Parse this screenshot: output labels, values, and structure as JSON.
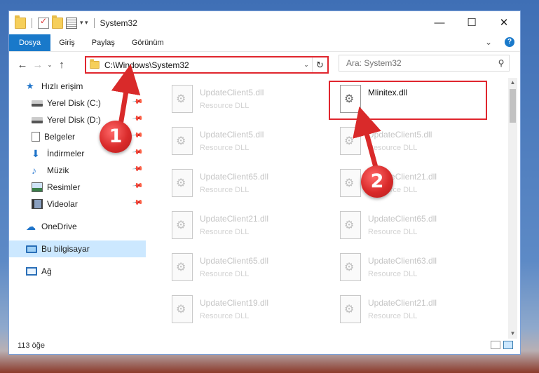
{
  "window": {
    "title": "System32"
  },
  "ribbon": {
    "tabs": [
      "Dosya",
      "Giriş",
      "Paylaş",
      "Görünüm"
    ]
  },
  "address": {
    "path": "C:\\Windows\\System32"
  },
  "search": {
    "placeholder": "Ara: System32"
  },
  "sidebar": {
    "quick_access": "Hızlı erişim",
    "items": [
      {
        "label": "Yerel Disk (C:)",
        "icon": "drive-icon"
      },
      {
        "label": "Yerel Disk (D:)",
        "icon": "drive-icon"
      },
      {
        "label": "Belgeler",
        "icon": "documents-icon"
      },
      {
        "label": "İndirmeler",
        "icon": "downloads-icon"
      },
      {
        "label": "Müzik",
        "icon": "music-icon"
      },
      {
        "label": "Resimler",
        "icon": "pictures-icon"
      },
      {
        "label": "Videolar",
        "icon": "videos-icon"
      }
    ],
    "onedrive": "OneDrive",
    "this_pc": "Bu bilgisayar",
    "network": "Ağ"
  },
  "files": {
    "left": [
      {
        "name": "UpdateClient5.dll",
        "type": "Resource DLL"
      },
      {
        "name": "UpdateClient5.dll",
        "type": "Resource DLL"
      },
      {
        "name": "UpdateClient65.dll",
        "type": "Resource DLL"
      },
      {
        "name": "UpdateClient21.dll",
        "type": "Resource DLL"
      },
      {
        "name": "UpdateClient65.dll",
        "type": "Resource DLL"
      },
      {
        "name": "UpdateClient19.dll",
        "type": "Resource DLL"
      }
    ],
    "right": [
      {
        "name": "Mlinitex.dll",
        "type": ""
      },
      {
        "name": "UpdateClient5.dll",
        "type": "Resource DLL"
      },
      {
        "name": "UpdateClient21.dll",
        "type": "Resource DLL"
      },
      {
        "name": "UpdateClient65.dll",
        "type": "Resource DLL"
      },
      {
        "name": "UpdateClient63.dll",
        "type": "Resource DLL"
      },
      {
        "name": "UpdateClient21.dll",
        "type": "Resource DLL"
      }
    ]
  },
  "status": {
    "count": "113 öğe"
  },
  "callouts": {
    "one": "1",
    "two": "2"
  },
  "colors": {
    "accent": "#1979ca",
    "highlight": "#e0262e"
  }
}
